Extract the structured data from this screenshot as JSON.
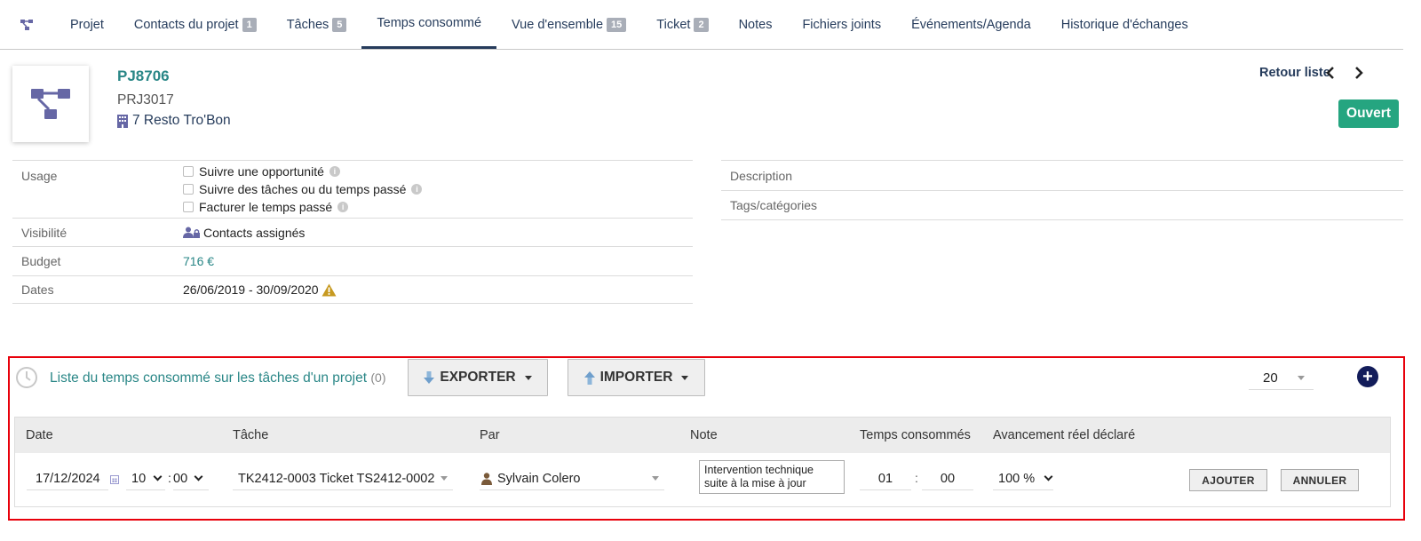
{
  "tabs": [
    {
      "label": "Projet"
    },
    {
      "label": "Contacts du projet",
      "badge": "1"
    },
    {
      "label": "Tâches",
      "badge": "5"
    },
    {
      "label": "Temps consommé",
      "active": true
    },
    {
      "label": "Vue d'ensemble",
      "badge": "15"
    },
    {
      "label": "Ticket",
      "badge": "2"
    },
    {
      "label": "Notes"
    },
    {
      "label": "Fichiers joints"
    },
    {
      "label": "Événements/Agenda"
    },
    {
      "label": "Historique d'échanges"
    }
  ],
  "project": {
    "ref": "PJ8706",
    "code": "PRJ3017",
    "company": "7 Resto Tro'Bon",
    "status": "Ouvert",
    "back_label": "Retour liste"
  },
  "fields": {
    "usage_label": "Usage",
    "usage_options": [
      "Suivre une opportunité",
      "Suivre des tâches ou du temps passé",
      "Facturer le temps passé"
    ],
    "visibility_label": "Visibilité",
    "visibility_value": "Contacts assignés",
    "budget_label": "Budget",
    "budget_value": "716 €",
    "dates_label": "Dates",
    "dates_value": "26/06/2019 - 30/09/2020"
  },
  "right_fields": {
    "description_label": "Description",
    "tags_label": "Tags/catégories"
  },
  "time_panel": {
    "title": "Liste du temps consommé sur les tâches d'un projet",
    "count": "(0)",
    "export_label": "EXPORTER",
    "import_label": "IMPORTER",
    "per_page": "20",
    "columns": {
      "date": "Date",
      "task": "Tâche",
      "by": "Par",
      "note": "Note",
      "time": "Temps consommés",
      "progress": "Avancement réel déclaré"
    },
    "row": {
      "date": "17/12/2024",
      "hour": "10",
      "minute": "00",
      "task": "TK2412-0003 Ticket TS2412-0002",
      "user": "Sylvain Colero",
      "note": "Intervention technique suite à la mise à jour",
      "time_hours": "01",
      "time_minutes": "00",
      "progress": "100 %"
    },
    "add_label": "AJOUTER",
    "cancel_label": "ANNULER"
  },
  "colors": {
    "accent": "#263c5c",
    "teal": "#2a8787",
    "status_green": "#25a580",
    "highlight_red": "#e8000b"
  }
}
